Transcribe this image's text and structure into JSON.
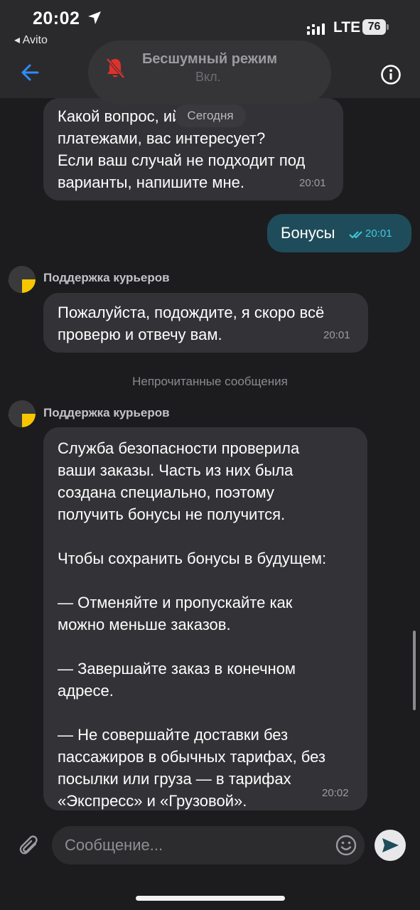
{
  "status_bar": {
    "time": "20:02",
    "back_app": "◂ Avito",
    "network": "LTE",
    "battery": "76"
  },
  "notification": {
    "title": "Бесшумный режим",
    "subtitle": "Вкл."
  },
  "date_separator": "Сегодня",
  "messages": [
    {
      "text": "Какой вопрос,          ий с\nплатежами, вас интересует?\nЕсли ваш случай не подходит под\nварианты, напишите мне.",
      "time": "20:01"
    },
    {
      "text": "Бонусы",
      "time": "20:01"
    },
    {
      "sender": "Поддержка курьеров",
      "text": "Пожалуйста, подождите, я скоро всё\nпроверю и отвечу вам.",
      "time": "20:01"
    },
    {
      "sender": "Поддержка курьеров",
      "text": "Служба безопасности проверила\nваши заказы. Часть из них была\nсоздана специально, поэтому\nполучить бонусы не получится.\n\nЧтобы сохранить бонусы в будущем:\n\n— Отменяйте и пропускайте как\nможно меньше заказов.\n\n— Завершайте заказ в конечном\nадресе.\n\n— Не совершайте доставки без\nпассажиров в обычных тарифах, без\nпосылки или груза — в тарифах\n«Экспресс» и «Грузовой».",
      "time": "20:02"
    }
  ],
  "unread_separator": "Непрочитанные сообщения",
  "composer": {
    "placeholder": "Сообщение..."
  },
  "colors": {
    "background": "#1c1c1e",
    "bubble_incoming": "#333337",
    "bubble_outgoing": "#1f4c5a",
    "accent": "#2f8cf5",
    "read_check": "#40c9de",
    "avatar_yellow": "#f7c600"
  },
  "icons": [
    "location-arrow-icon",
    "signal-icon",
    "back-arrow-icon",
    "bell-off-icon",
    "info-icon",
    "double-check-icon",
    "paperclip-icon",
    "emoji-icon",
    "send-icon"
  ]
}
